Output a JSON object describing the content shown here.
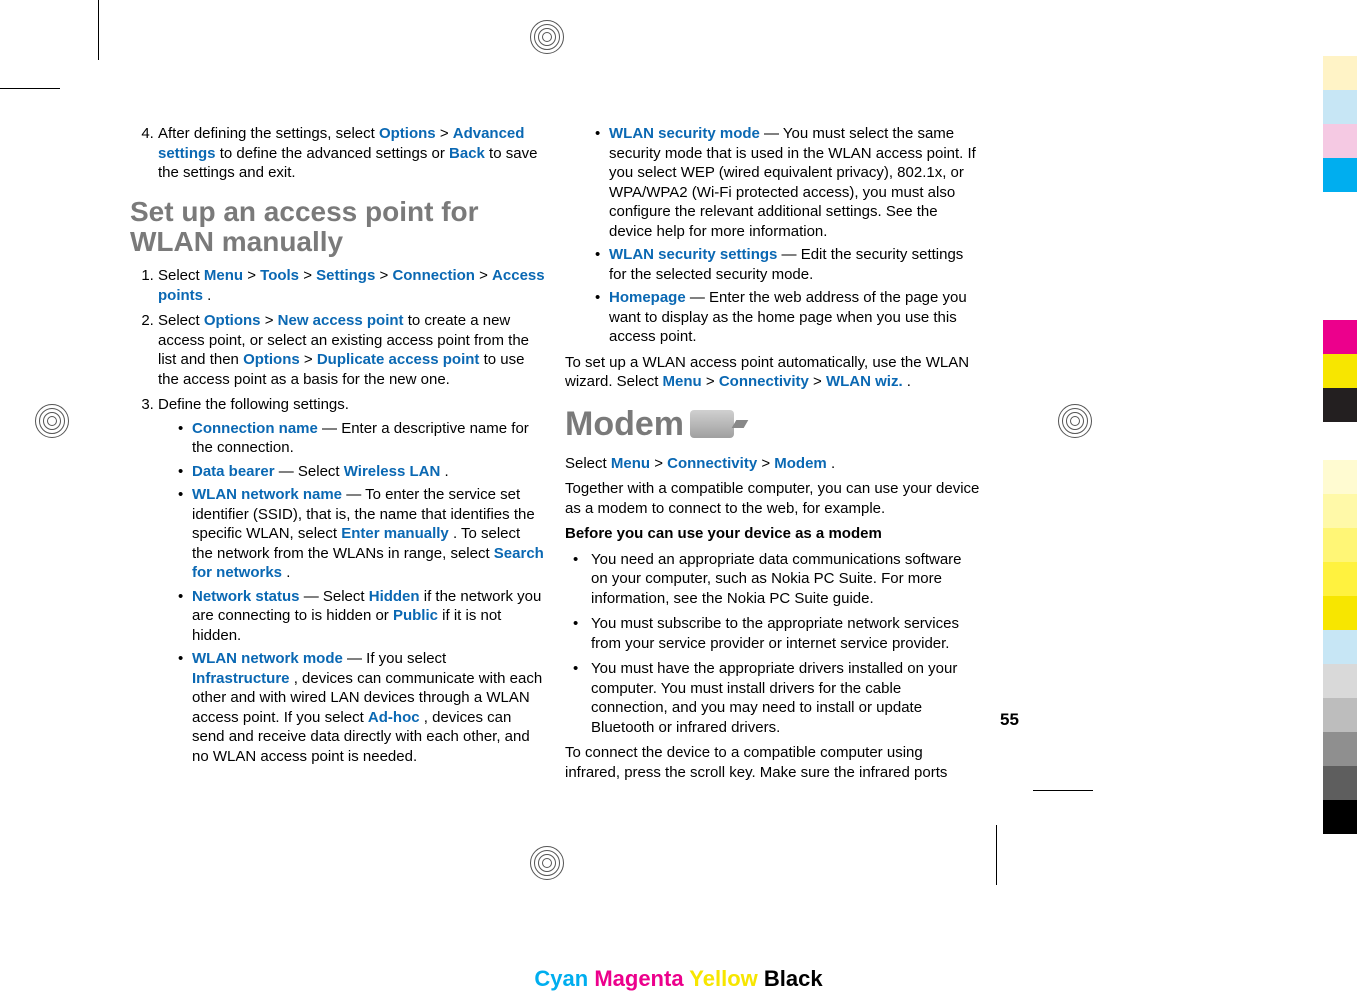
{
  "left": {
    "step4_pre": "After defining the settings, select ",
    "step4_opt": "Options",
    "step4_gt1": " > ",
    "step4_adv": "Advanced settings",
    "step4_mid": " to define the advanced settings or ",
    "step4_back": "Back",
    "step4_end": " to save the settings and exit.",
    "heading": "Set up an access point for WLAN manually",
    "s1_pre": "Select ",
    "s1_menu": "Menu",
    "s1_g1": " > ",
    "s1_tools": "Tools",
    "s1_g2": " > ",
    "s1_settings": "Settings",
    "s1_g3": " > ",
    "s1_conn": "Connection",
    "s1_g4": " > ",
    "s1_ap": "Access points",
    "s1_end": ".",
    "s2_pre": "Select ",
    "s2_opt": "Options",
    "s2_g1": " > ",
    "s2_nap": "New access point",
    "s2_mid": " to create a new access point, or select an existing access point from the list and then ",
    "s2_opt2": "Options",
    "s2_g2": " > ",
    "s2_dup": "Duplicate access point",
    "s2_end": " to use the access point as a basis for the new one.",
    "s3": "Define the following settings.",
    "b1_t": "Connection name",
    "b1_r": " — Enter a descriptive name for the connection.",
    "b2_t": "Data bearer",
    "b2_r1": " — Select ",
    "b2_wl": "Wireless LAN",
    "b2_end": ".",
    "b3_t": "WLAN network name",
    "b3_r1": " — To enter the service set identifier (SSID), that is, the name that identifies the specific WLAN, select ",
    "b3_em": "Enter manually",
    "b3_r2": ". To select the network from the WLANs in range, select ",
    "b3_sf": "Search for networks",
    "b3_end": ".",
    "b4_t": "Network status",
    "b4_r1": " — Select ",
    "b4_h": "Hidden",
    "b4_r2": " if the network you are connecting to is hidden or ",
    "b4_p": "Public",
    "b4_end": " if it is not hidden.",
    "b5_t": "WLAN network mode",
    "b5_r1": " — If you select ",
    "b5_inf": "Infrastructure",
    "b5_r2": ", devices can communicate with each other and with wired LAN devices through a WLAN access point. If you select ",
    "b5_ah": "Ad-hoc",
    "b5_end": ", devices can send and receive data directly with each other, and no WLAN access point is needed."
  },
  "right": {
    "r1_t": "WLAN security mode",
    "r1_r": " — You must select the same security mode that is used in the WLAN access point. If you select WEP (wired equivalent privacy), 802.1x, or WPA/WPA2 (Wi-Fi protected access), you must also configure the relevant additional settings. See the device help for more information.",
    "r2_t": "WLAN security settings",
    "r2_r": " — Edit the security settings for the selected security mode.",
    "r3_t": "Homepage",
    "r3_r": " — Enter the web address of the page you want to display as the home page when you use this access point.",
    "wiz_pre": "To set up a WLAN access point automatically, use the WLAN wizard. Select ",
    "wiz_menu": "Menu",
    "wiz_g1": " > ",
    "wiz_con": "Connectivity",
    "wiz_g2": " > ",
    "wiz_w": "WLAN wiz.",
    "wiz_end": ".",
    "modem_h": "Modem",
    "m_sel_pre": "Select ",
    "m_menu": "Menu",
    "m_g1": " > ",
    "m_con": "Connectivity",
    "m_g2": " > ",
    "m_mod": "Modem",
    "m_end": ".",
    "m_p1": "Together with a compatible computer, you can use your device as a modem to connect to the web, for example.",
    "m_before": "Before you can use your device as a modem",
    "m_b1": "You need an appropriate data communications software on your computer, such as Nokia PC Suite. For more information, see the Nokia PC Suite guide.",
    "m_b2": "You must subscribe to the appropriate network services from your service provider or internet service provider.",
    "m_b3": "You must have the appropriate drivers installed on your computer. You must install drivers for the cable connection, and you may need to install or update Bluetooth or infrared drivers.",
    "m_p2": "To connect the device to a compatible computer using infrared, press the scroll key. Make sure the infrared ports"
  },
  "pagenum": "55",
  "cmyk": {
    "c": "Cyan",
    "m": "Magenta",
    "y": "Yellow",
    "k": "Black"
  }
}
